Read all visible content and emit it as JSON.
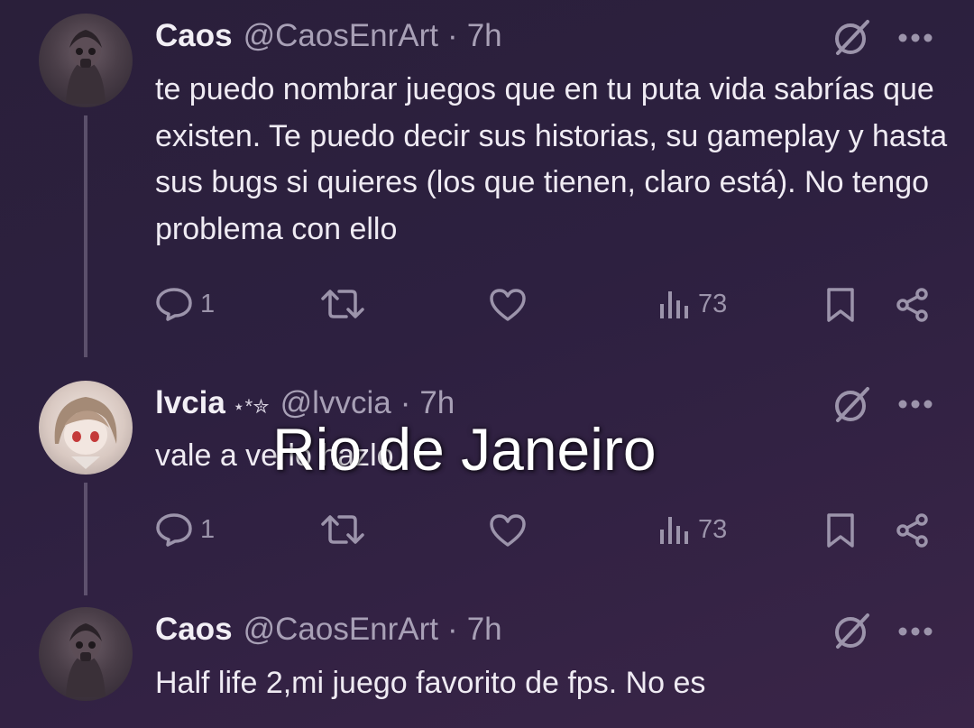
{
  "tweets": [
    {
      "display_name": "Caos",
      "handle": "@CaosEnrArt",
      "separator": "·",
      "time": "7h",
      "text": "te puedo nombrar juegos que en tu puta vida sabrías que existen. Te puedo decir sus historias, su gameplay y hasta sus bugs si quieres (los que tienen, claro está). No tengo problema con ello",
      "replies": "1",
      "views": "73"
    },
    {
      "display_name": "lvcia",
      "badge": "⋆*✮",
      "handle": "@lvvcia",
      "separator": "·",
      "time": "7h",
      "text": "vale a verlo hazlo",
      "replies": "1",
      "views": "73"
    },
    {
      "display_name": "Caos",
      "handle": "@CaosEnrArt",
      "separator": "·",
      "time": "7h",
      "text": "Half life 2,mi juego favorito de fps. No es"
    }
  ],
  "overlay": {
    "caption": "Rio de Janeiro"
  },
  "colors": {
    "background": "#2d2040",
    "icon": "#9c94ab",
    "text": "#efebf3"
  }
}
